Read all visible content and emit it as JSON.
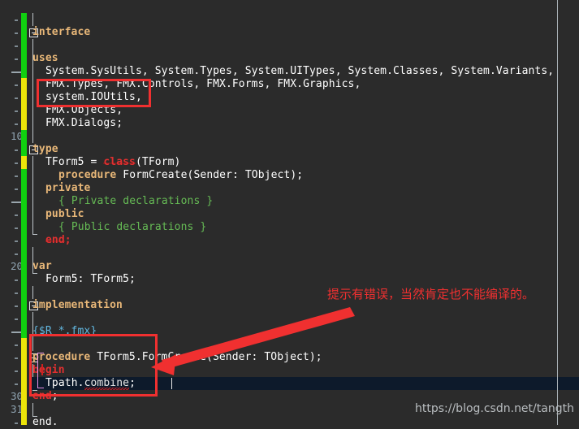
{
  "editor": {
    "background_color": "#2b2b2b",
    "current_line_color": "#0d1a2b",
    "keyword_color": "#e8b778",
    "comment_color": "#66bb55",
    "directive_color": "#62b7e0",
    "error_color": "#e03030",
    "change_bar_saved_color": "#10d010",
    "change_bar_modified_color": "#ece40a",
    "caret_visible": true,
    "current_line_number": "31",
    "margin_guide_column_x": "686"
  },
  "gutter": {
    "visible_line_numbers": [
      "10",
      "20",
      "30",
      "31"
    ]
  },
  "lines": [
    {
      "num": "1",
      "indent": 0,
      "tokens": []
    },
    {
      "num": "2",
      "indent": 0,
      "tokens": [
        {
          "t": "interface",
          "c": "kw"
        }
      ]
    },
    {
      "num": "3",
      "indent": 0,
      "tokens": []
    },
    {
      "num": "4",
      "indent": 0,
      "tokens": [
        {
          "t": "uses",
          "c": "kw"
        }
      ]
    },
    {
      "num": "5",
      "indent": 1,
      "tokens": [
        {
          "t": "System.SysUtils, System.Types, System.UITypes, System.Classes, System.Variants,",
          "c": "id"
        }
      ]
    },
    {
      "num": "6",
      "indent": 1,
      "tokens": [
        {
          "t": "FMX.Types, FMX.Controls, FMX.Forms, FMX.Graphics,",
          "c": "id"
        }
      ]
    },
    {
      "num": "7",
      "indent": 1,
      "tokens": [
        {
          "t": "system.IOUtils,",
          "c": "id"
        }
      ]
    },
    {
      "num": "8",
      "indent": 1,
      "tokens": [
        {
          "t": "FMX.Objects,",
          "c": "id"
        }
      ]
    },
    {
      "num": "9",
      "indent": 1,
      "tokens": [
        {
          "t": "FMX.Dialogs;",
          "c": "id"
        }
      ]
    },
    {
      "num": "10",
      "indent": 0,
      "tokens": []
    },
    {
      "num": "11",
      "indent": 0,
      "tokens": [
        {
          "t": "type",
          "c": "kw"
        }
      ]
    },
    {
      "num": "12",
      "indent": 1,
      "tokens": [
        {
          "t": "TForm5 = ",
          "c": "id"
        },
        {
          "t": "class",
          "c": "errstrike"
        },
        {
          "t": "(TForm)",
          "c": "id"
        }
      ]
    },
    {
      "num": "13",
      "indent": 2,
      "tokens": [
        {
          "t": "procedure",
          "c": "kw"
        },
        {
          "t": " FormCreate(Sender: TObject);",
          "c": "id"
        }
      ]
    },
    {
      "num": "14",
      "indent": 1,
      "tokens": [
        {
          "t": "private",
          "c": "kw"
        }
      ]
    },
    {
      "num": "15",
      "indent": 2,
      "tokens": [
        {
          "t": "{ Private declarations }",
          "c": "cm"
        }
      ]
    },
    {
      "num": "16",
      "indent": 1,
      "tokens": [
        {
          "t": "public",
          "c": "kw"
        }
      ]
    },
    {
      "num": "17",
      "indent": 2,
      "tokens": [
        {
          "t": "{ Public declarations }",
          "c": "cm"
        }
      ]
    },
    {
      "num": "18",
      "indent": 1,
      "tokens": [
        {
          "t": "end",
          "c": "errstrike"
        },
        {
          "t": ";",
          "c": "err"
        }
      ]
    },
    {
      "num": "19",
      "indent": 0,
      "tokens": []
    },
    {
      "num": "20",
      "indent": 0,
      "tokens": [
        {
          "t": "var",
          "c": "kw"
        }
      ]
    },
    {
      "num": "21",
      "indent": 1,
      "tokens": [
        {
          "t": "Form5: TForm5;",
          "c": "id"
        }
      ]
    },
    {
      "num": "22",
      "indent": 0,
      "tokens": []
    },
    {
      "num": "23",
      "indent": 0,
      "tokens": [
        {
          "t": "implementation",
          "c": "kw"
        }
      ]
    },
    {
      "num": "24",
      "indent": 0,
      "tokens": []
    },
    {
      "num": "25",
      "indent": 0,
      "tokens": [
        {
          "t": "{$R *.fmx}",
          "c": "dir"
        }
      ]
    },
    {
      "num": "26",
      "indent": 0,
      "tokens": []
    },
    {
      "num": "27",
      "indent": 0,
      "tokens": [
        {
          "t": "procedure",
          "c": "kw"
        },
        {
          "t": " TForm5.FormCreate(Sender: TObject);",
          "c": "id"
        }
      ]
    },
    {
      "num": "28",
      "indent": 0,
      "tokens": [
        {
          "t": "begin",
          "c": "err"
        }
      ]
    },
    {
      "num": "29",
      "indent": 1,
      "tokens": [
        {
          "t": "Tpath.",
          "c": "id"
        },
        {
          "t": "combine",
          "c": "sq"
        },
        {
          "t": ";",
          "c": "id"
        }
      ]
    },
    {
      "num": "30",
      "indent": 0,
      "tokens": [
        {
          "t": "end",
          "c": "err"
        },
        {
          "t": ";",
          "c": "id"
        }
      ]
    },
    {
      "num": "31",
      "indent": 0,
      "tokens": []
    },
    {
      "num": "32",
      "indent": 0,
      "tokens": [
        {
          "t": "end.",
          "c": "id"
        }
      ]
    }
  ],
  "annotations": {
    "box_uses_label": "uses-clause-highlight",
    "box_body_label": "procedure-body-highlight",
    "note_text": "提示有错误，当然肯定也不能编译的。",
    "note_color": "#f03030",
    "arrow_color": "#f03030"
  },
  "watermark": {
    "text": "https://blog.csdn.net/tangth",
    "color": "#b9bdc0"
  }
}
